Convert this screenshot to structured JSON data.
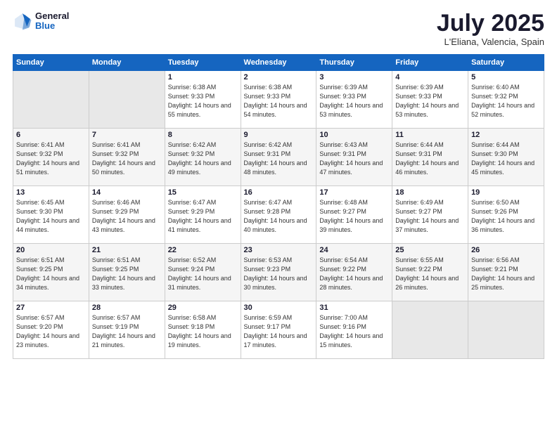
{
  "logo": {
    "general": "General",
    "blue": "Blue"
  },
  "title": {
    "month": "July 2025",
    "location": "L'Eliana, Valencia, Spain"
  },
  "weekdays": [
    "Sunday",
    "Monday",
    "Tuesday",
    "Wednesday",
    "Thursday",
    "Friday",
    "Saturday"
  ],
  "weeks": [
    [
      {
        "day": "",
        "sunrise": "",
        "sunset": "",
        "daylight": ""
      },
      {
        "day": "",
        "sunrise": "",
        "sunset": "",
        "daylight": ""
      },
      {
        "day": "1",
        "sunrise": "Sunrise: 6:38 AM",
        "sunset": "Sunset: 9:33 PM",
        "daylight": "Daylight: 14 hours and 55 minutes."
      },
      {
        "day": "2",
        "sunrise": "Sunrise: 6:38 AM",
        "sunset": "Sunset: 9:33 PM",
        "daylight": "Daylight: 14 hours and 54 minutes."
      },
      {
        "day": "3",
        "sunrise": "Sunrise: 6:39 AM",
        "sunset": "Sunset: 9:33 PM",
        "daylight": "Daylight: 14 hours and 53 minutes."
      },
      {
        "day": "4",
        "sunrise": "Sunrise: 6:39 AM",
        "sunset": "Sunset: 9:33 PM",
        "daylight": "Daylight: 14 hours and 53 minutes."
      },
      {
        "day": "5",
        "sunrise": "Sunrise: 6:40 AM",
        "sunset": "Sunset: 9:32 PM",
        "daylight": "Daylight: 14 hours and 52 minutes."
      }
    ],
    [
      {
        "day": "6",
        "sunrise": "Sunrise: 6:41 AM",
        "sunset": "Sunset: 9:32 PM",
        "daylight": "Daylight: 14 hours and 51 minutes."
      },
      {
        "day": "7",
        "sunrise": "Sunrise: 6:41 AM",
        "sunset": "Sunset: 9:32 PM",
        "daylight": "Daylight: 14 hours and 50 minutes."
      },
      {
        "day": "8",
        "sunrise": "Sunrise: 6:42 AM",
        "sunset": "Sunset: 9:32 PM",
        "daylight": "Daylight: 14 hours and 49 minutes."
      },
      {
        "day": "9",
        "sunrise": "Sunrise: 6:42 AM",
        "sunset": "Sunset: 9:31 PM",
        "daylight": "Daylight: 14 hours and 48 minutes."
      },
      {
        "day": "10",
        "sunrise": "Sunrise: 6:43 AM",
        "sunset": "Sunset: 9:31 PM",
        "daylight": "Daylight: 14 hours and 47 minutes."
      },
      {
        "day": "11",
        "sunrise": "Sunrise: 6:44 AM",
        "sunset": "Sunset: 9:31 PM",
        "daylight": "Daylight: 14 hours and 46 minutes."
      },
      {
        "day": "12",
        "sunrise": "Sunrise: 6:44 AM",
        "sunset": "Sunset: 9:30 PM",
        "daylight": "Daylight: 14 hours and 45 minutes."
      }
    ],
    [
      {
        "day": "13",
        "sunrise": "Sunrise: 6:45 AM",
        "sunset": "Sunset: 9:30 PM",
        "daylight": "Daylight: 14 hours and 44 minutes."
      },
      {
        "day": "14",
        "sunrise": "Sunrise: 6:46 AM",
        "sunset": "Sunset: 9:29 PM",
        "daylight": "Daylight: 14 hours and 43 minutes."
      },
      {
        "day": "15",
        "sunrise": "Sunrise: 6:47 AM",
        "sunset": "Sunset: 9:29 PM",
        "daylight": "Daylight: 14 hours and 41 minutes."
      },
      {
        "day": "16",
        "sunrise": "Sunrise: 6:47 AM",
        "sunset": "Sunset: 9:28 PM",
        "daylight": "Daylight: 14 hours and 40 minutes."
      },
      {
        "day": "17",
        "sunrise": "Sunrise: 6:48 AM",
        "sunset": "Sunset: 9:27 PM",
        "daylight": "Daylight: 14 hours and 39 minutes."
      },
      {
        "day": "18",
        "sunrise": "Sunrise: 6:49 AM",
        "sunset": "Sunset: 9:27 PM",
        "daylight": "Daylight: 14 hours and 37 minutes."
      },
      {
        "day": "19",
        "sunrise": "Sunrise: 6:50 AM",
        "sunset": "Sunset: 9:26 PM",
        "daylight": "Daylight: 14 hours and 36 minutes."
      }
    ],
    [
      {
        "day": "20",
        "sunrise": "Sunrise: 6:51 AM",
        "sunset": "Sunset: 9:25 PM",
        "daylight": "Daylight: 14 hours and 34 minutes."
      },
      {
        "day": "21",
        "sunrise": "Sunrise: 6:51 AM",
        "sunset": "Sunset: 9:25 PM",
        "daylight": "Daylight: 14 hours and 33 minutes."
      },
      {
        "day": "22",
        "sunrise": "Sunrise: 6:52 AM",
        "sunset": "Sunset: 9:24 PM",
        "daylight": "Daylight: 14 hours and 31 minutes."
      },
      {
        "day": "23",
        "sunrise": "Sunrise: 6:53 AM",
        "sunset": "Sunset: 9:23 PM",
        "daylight": "Daylight: 14 hours and 30 minutes."
      },
      {
        "day": "24",
        "sunrise": "Sunrise: 6:54 AM",
        "sunset": "Sunset: 9:22 PM",
        "daylight": "Daylight: 14 hours and 28 minutes."
      },
      {
        "day": "25",
        "sunrise": "Sunrise: 6:55 AM",
        "sunset": "Sunset: 9:22 PM",
        "daylight": "Daylight: 14 hours and 26 minutes."
      },
      {
        "day": "26",
        "sunrise": "Sunrise: 6:56 AM",
        "sunset": "Sunset: 9:21 PM",
        "daylight": "Daylight: 14 hours and 25 minutes."
      }
    ],
    [
      {
        "day": "27",
        "sunrise": "Sunrise: 6:57 AM",
        "sunset": "Sunset: 9:20 PM",
        "daylight": "Daylight: 14 hours and 23 minutes."
      },
      {
        "day": "28",
        "sunrise": "Sunrise: 6:57 AM",
        "sunset": "Sunset: 9:19 PM",
        "daylight": "Daylight: 14 hours and 21 minutes."
      },
      {
        "day": "29",
        "sunrise": "Sunrise: 6:58 AM",
        "sunset": "Sunset: 9:18 PM",
        "daylight": "Daylight: 14 hours and 19 minutes."
      },
      {
        "day": "30",
        "sunrise": "Sunrise: 6:59 AM",
        "sunset": "Sunset: 9:17 PM",
        "daylight": "Daylight: 14 hours and 17 minutes."
      },
      {
        "day": "31",
        "sunrise": "Sunrise: 7:00 AM",
        "sunset": "Sunset: 9:16 PM",
        "daylight": "Daylight: 14 hours and 15 minutes."
      },
      {
        "day": "",
        "sunrise": "",
        "sunset": "",
        "daylight": ""
      },
      {
        "day": "",
        "sunrise": "",
        "sunset": "",
        "daylight": ""
      }
    ]
  ]
}
